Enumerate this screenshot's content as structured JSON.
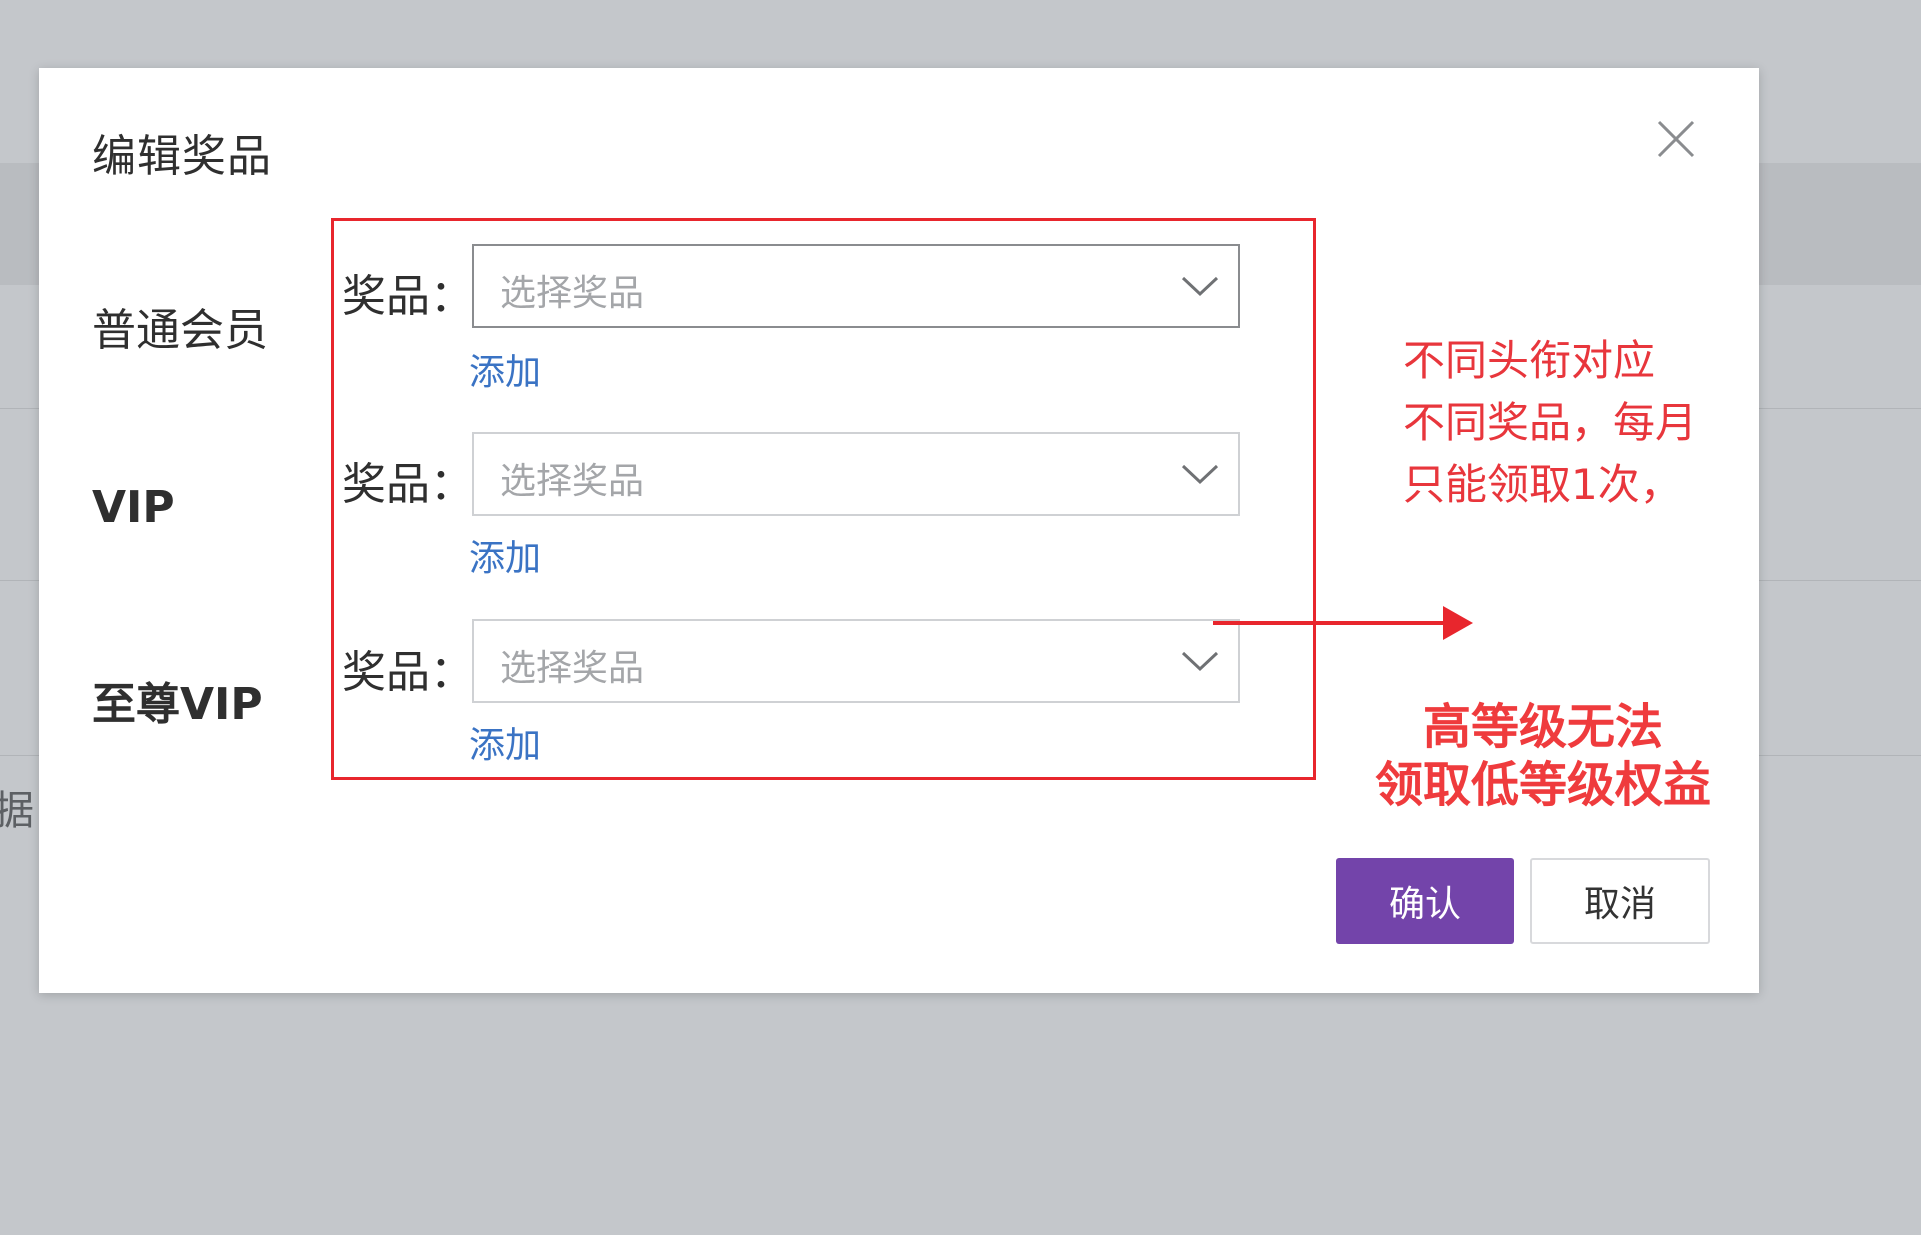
{
  "background": {
    "partial_text": "据"
  },
  "modal": {
    "title": "编辑奖品",
    "close_icon": "close-icon",
    "levels": [
      {
        "label": "普通会员",
        "prize_label": "奖品：",
        "select_placeholder": "选择奖品",
        "add_label": "添加"
      },
      {
        "label": "VIP",
        "prize_label": "奖品：",
        "select_placeholder": "选择奖品",
        "add_label": "添加"
      },
      {
        "label": "至尊VIP",
        "prize_label": "奖品：",
        "select_placeholder": "选择奖品",
        "add_label": "添加"
      }
    ],
    "confirm_label": "确认",
    "cancel_label": "取消"
  },
  "annotation": {
    "note_lines": [
      "不同头衔对应",
      "不同奖品，每月",
      "只能领取1次，"
    ],
    "strong_lines": [
      "高等级无法",
      "领取低等级权益"
    ],
    "box_color": "#e8262d",
    "text_color": "#e8363c"
  },
  "colors": {
    "primary_button": "#7344aa",
    "link": "#3a73c4"
  }
}
